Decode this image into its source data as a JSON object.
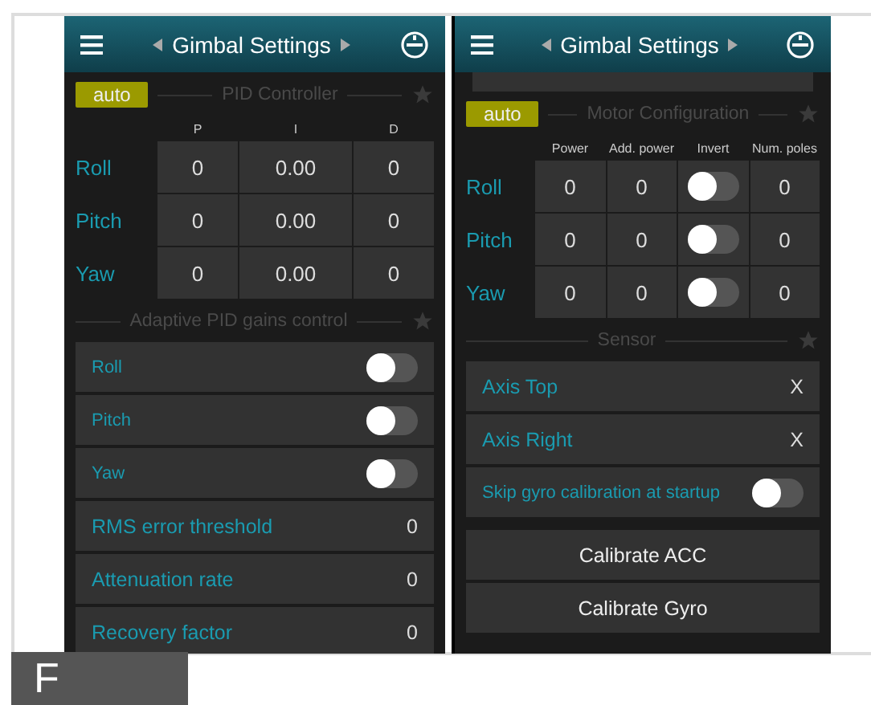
{
  "screens": [
    {
      "title": "Gimbal Settings",
      "sections": [
        {
          "kind": "table",
          "badge": "auto",
          "title": "PID Controller",
          "columns": [
            "P",
            "I",
            "D"
          ],
          "rows": [
            {
              "label": "Roll",
              "cells": [
                {
                  "kind": "value",
                  "text": "0"
                },
                {
                  "kind": "value",
                  "text": "0.00"
                },
                {
                  "kind": "value",
                  "text": "0"
                }
              ]
            },
            {
              "label": "Pitch",
              "cells": [
                {
                  "kind": "value",
                  "text": "0"
                },
                {
                  "kind": "value",
                  "text": "0.00"
                },
                {
                  "kind": "value",
                  "text": "0"
                }
              ]
            },
            {
              "label": "Yaw",
              "cells": [
                {
                  "kind": "value",
                  "text": "0"
                },
                {
                  "kind": "value",
                  "text": "0.00"
                },
                {
                  "kind": "value",
                  "text": "0"
                }
              ]
            }
          ]
        },
        {
          "kind": "list",
          "title": "Adaptive PID gains control",
          "items": [
            {
              "kind": "switch",
              "label": "Roll",
              "on": false
            },
            {
              "kind": "switch",
              "label": "Pitch",
              "on": false
            },
            {
              "kind": "switch",
              "label": "Yaw",
              "on": false
            },
            {
              "kind": "value",
              "label": "RMS error threshold",
              "value": "0"
            },
            {
              "kind": "value",
              "label": "Attenuation rate",
              "value": "0"
            },
            {
              "kind": "value",
              "label": "Recovery factor",
              "value": "0"
            }
          ]
        }
      ]
    },
    {
      "title": "Gimbal Settings",
      "sections": [
        {
          "kind": "cut-card"
        },
        {
          "kind": "table",
          "badge": "auto",
          "title": "Motor Configuration",
          "columns": [
            "Power",
            "Add. power",
            "Invert",
            "Num. poles"
          ],
          "rows": [
            {
              "label": "Roll",
              "cells": [
                {
                  "kind": "value",
                  "text": "0"
                },
                {
                  "kind": "value",
                  "text": "0"
                },
                {
                  "kind": "switch",
                  "on": false
                },
                {
                  "kind": "value",
                  "text": "0"
                }
              ]
            },
            {
              "label": "Pitch",
              "cells": [
                {
                  "kind": "value",
                  "text": "0"
                },
                {
                  "kind": "value",
                  "text": "0"
                },
                {
                  "kind": "switch",
                  "on": false
                },
                {
                  "kind": "value",
                  "text": "0"
                }
              ]
            },
            {
              "label": "Yaw",
              "cells": [
                {
                  "kind": "value",
                  "text": "0"
                },
                {
                  "kind": "value",
                  "text": "0"
                },
                {
                  "kind": "switch",
                  "on": false
                },
                {
                  "kind": "value",
                  "text": "0"
                }
              ]
            }
          ]
        },
        {
          "kind": "list",
          "title": "Sensor",
          "items": [
            {
              "kind": "value",
              "label": "Axis Top",
              "value": "X"
            },
            {
              "kind": "value",
              "label": "Axis Right",
              "value": "X"
            },
            {
              "kind": "switch",
              "label": "Skip gyro calibration at startup",
              "on": false
            }
          ]
        },
        {
          "kind": "buttons",
          "items": [
            "Calibrate ACC",
            "Calibrate Gyro"
          ]
        }
      ]
    }
  ],
  "footer_tab": "F"
}
